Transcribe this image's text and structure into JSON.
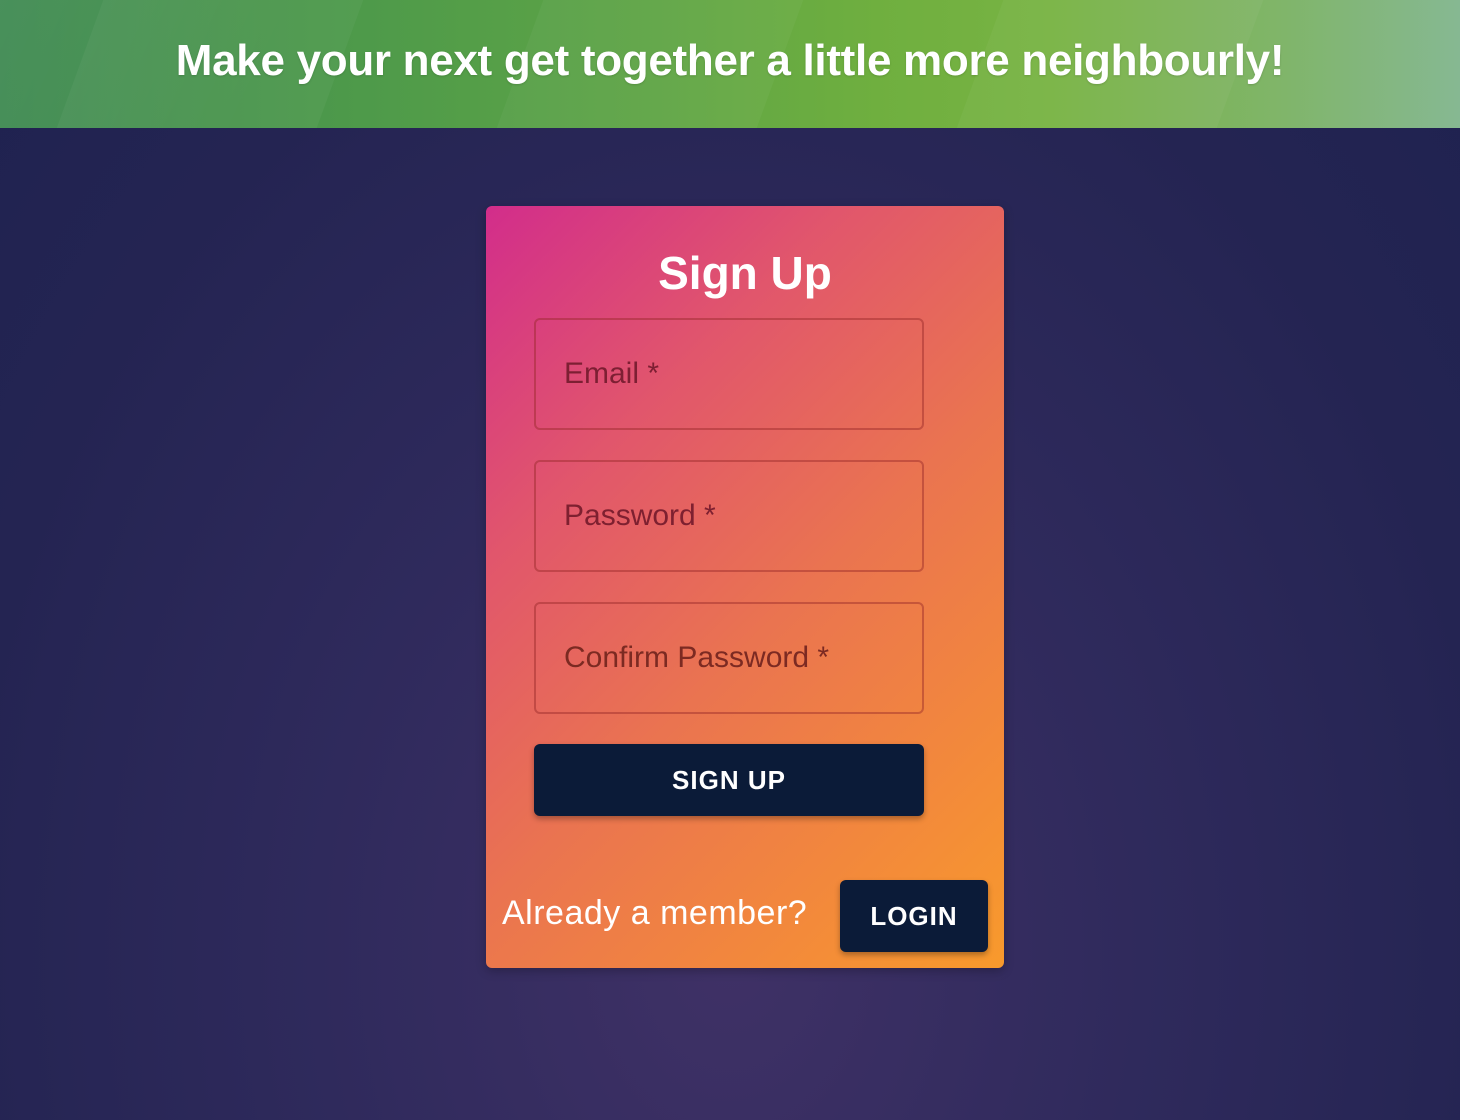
{
  "banner": {
    "title": "Make your next get together a little more neighbourly!"
  },
  "signup_card": {
    "title": "Sign Up",
    "fields": {
      "email_placeholder": "Email *",
      "password_placeholder": "Password *",
      "confirm_password_placeholder": "Confirm Password *"
    },
    "signup_button_label": "SIGN UP",
    "member_prompt": "Already a member?",
    "login_button_label": "LOGIN"
  },
  "colors": {
    "banner_green": "#5fa545",
    "page_background": "#2f2a5c",
    "card_gradient_start": "#d22d8b",
    "card_gradient_end": "#f89a2c",
    "button_navy": "#0b1b38"
  }
}
